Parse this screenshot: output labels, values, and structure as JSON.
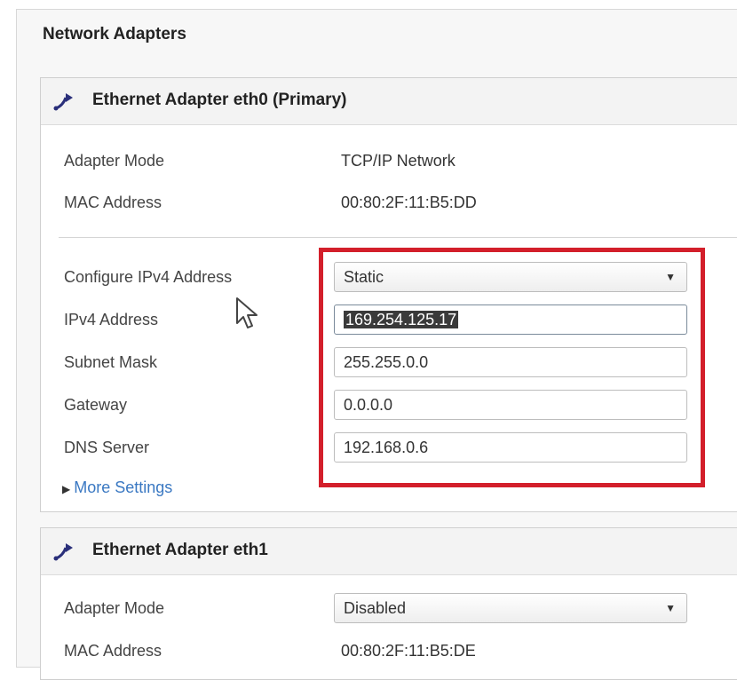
{
  "section_title": "Network Adapters",
  "eth0": {
    "title": "Ethernet Adapter eth0 (Primary)",
    "adapter_mode_label": "Adapter Mode",
    "adapter_mode_value": "TCP/IP Network",
    "mac_label": "MAC Address",
    "mac_value": "00:80:2F:11:B5:DD",
    "configure_label": "Configure IPv4 Address",
    "configure_value": "Static",
    "ipv4_label": "IPv4 Address",
    "ipv4_value": "169.254.125.17",
    "subnet_label": "Subnet Mask",
    "subnet_value": "255.255.0.0",
    "gateway_label": "Gateway",
    "gateway_value": "0.0.0.0",
    "dns_label": "DNS Server",
    "dns_value": "192.168.0.6",
    "more_settings": "More Settings"
  },
  "eth1": {
    "title": "Ethernet Adapter eth1",
    "adapter_mode_label": "Adapter Mode",
    "adapter_mode_value": "Disabled",
    "mac_label": "MAC Address",
    "mac_value": "00:80:2F:11:B5:DE"
  },
  "colors": {
    "highlight": "#d31f2b",
    "link": "#3a78c2"
  },
  "icons": {
    "adapter": "network-adapter-icon",
    "dropdown": "chevron-down-icon",
    "expand": "triangle-right-icon",
    "cursor": "mouse-pointer-icon"
  }
}
